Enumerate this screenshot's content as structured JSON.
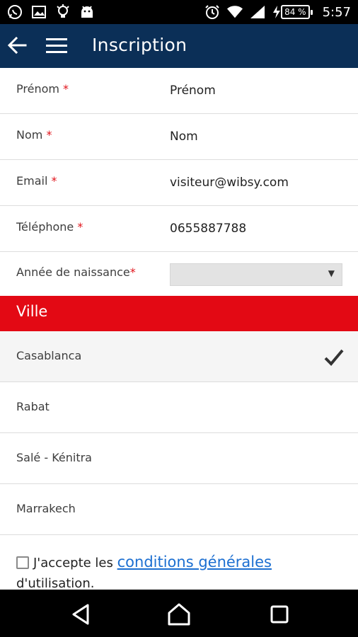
{
  "status_bar": {
    "time": "5:57",
    "battery_percent": "84 %",
    "icons": [
      "whatsapp-icon",
      "image-icon",
      "bulb-icon",
      "android-icon",
      "alarm-icon",
      "wifi-icon",
      "signal-icon",
      "charging-icon"
    ]
  },
  "appbar": {
    "title": "Inscription",
    "back_icon": "arrow-left-icon",
    "menu_icon": "hamburger-menu-icon",
    "background_color": "#0b2f57"
  },
  "form": {
    "fields": [
      {
        "label": "Prénom",
        "required_mark": "*",
        "value": "Prénom"
      },
      {
        "label": "Nom",
        "required_mark": "*",
        "value": "Nom"
      },
      {
        "label": "Email",
        "required_mark": "*",
        "value": "visiteur@wibsy.com"
      },
      {
        "label": "Téléphone",
        "required_mark": "*",
        "value": "0655887788"
      }
    ],
    "birth_year": {
      "label": "Année de naissance",
      "required_mark": "*",
      "value": ""
    }
  },
  "ville": {
    "header": "Ville",
    "header_color": "#e30914",
    "cities": [
      "Casablanca",
      "Rabat",
      "Salé - Kénitra",
      "Marrakech"
    ],
    "selected": "Casablanca"
  },
  "terms": {
    "text_before": "J'accepte les ",
    "link_text": "conditions générales",
    "text_after": "d'utilisation.",
    "checked": false
  },
  "navbar": {
    "buttons": [
      "back-triangle-icon",
      "home-icon",
      "recents-square-icon"
    ]
  }
}
